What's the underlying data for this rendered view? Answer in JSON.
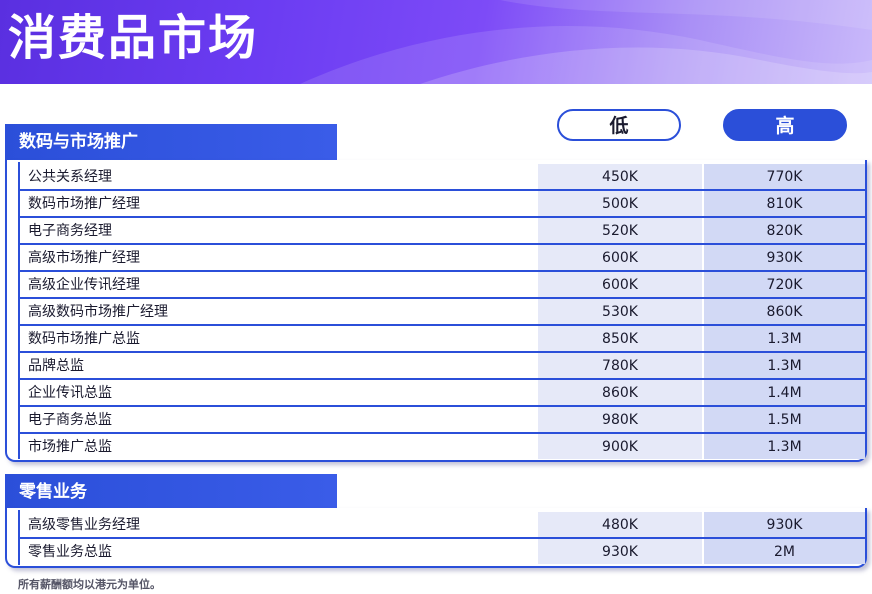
{
  "banner": {
    "title": "消费品市场"
  },
  "columns": {
    "low": "低",
    "high": "高"
  },
  "sections": [
    {
      "title": "数码与市场推广",
      "rows": [
        {
          "role": "公共关系经理",
          "low": "450K",
          "high": "770K"
        },
        {
          "role": "数码市场推广经理",
          "low": "500K",
          "high": "810K"
        },
        {
          "role": "电子商务经理",
          "low": "520K",
          "high": "820K"
        },
        {
          "role": "高级市场推广经理",
          "low": "600K",
          "high": "930K"
        },
        {
          "role": "高级企业传讯经理",
          "low": "600K",
          "high": "720K"
        },
        {
          "role": "高级数码市场推广经理",
          "low": "530K",
          "high": "860K"
        },
        {
          "role": "数码市场推广总监",
          "low": "850K",
          "high": "1.3M"
        },
        {
          "role": "品牌总监",
          "low": "780K",
          "high": "1.3M"
        },
        {
          "role": "企业传讯总监",
          "low": "860K",
          "high": "1.4M"
        },
        {
          "role": "电子商务总监",
          "low": "980K",
          "high": "1.5M"
        },
        {
          "role": "市场推广总监",
          "low": "900K",
          "high": "1.3M"
        }
      ]
    },
    {
      "title": "零售业务",
      "rows": [
        {
          "role": "高级零售业务经理",
          "low": "480K",
          "high": "930K"
        },
        {
          "role": "零售业务总监",
          "low": "930K",
          "high": "2M"
        }
      ]
    }
  ],
  "footnote": "所有薪酬额均以港元为单位。"
}
